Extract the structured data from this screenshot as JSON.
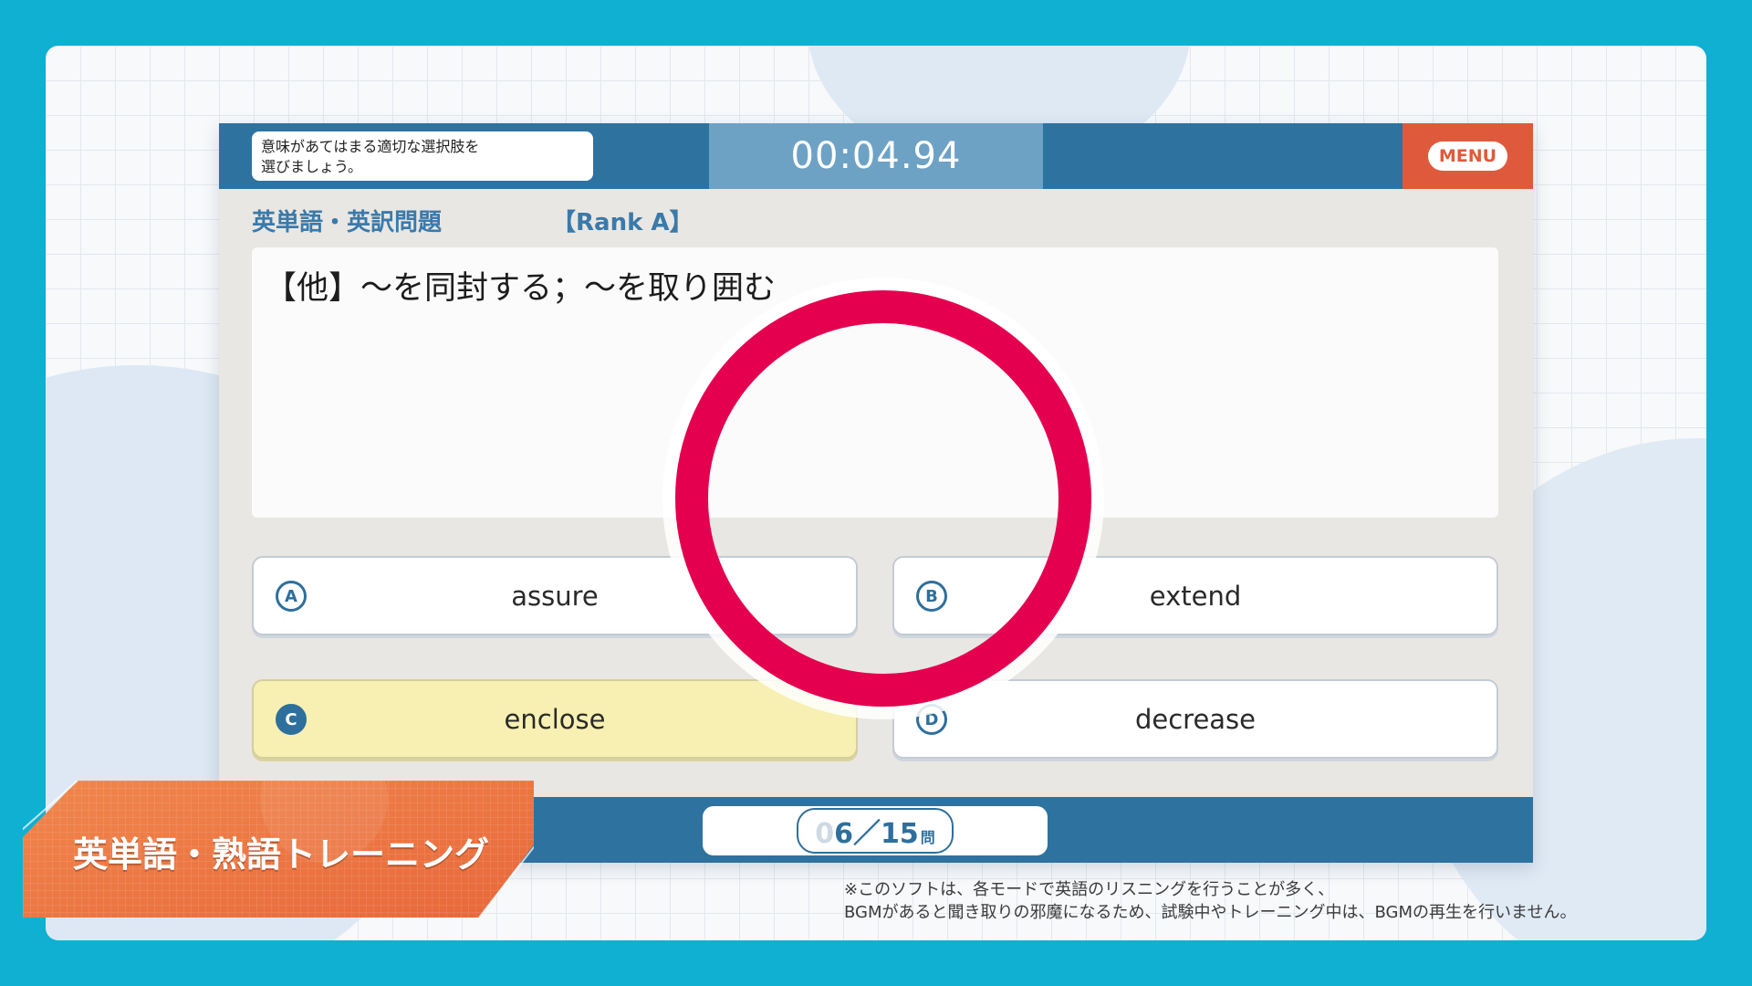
{
  "instruction": {
    "line1": "意味があてはまる適切な選択肢を",
    "line2": "選びましょう。"
  },
  "timer": "00:04.94",
  "menu_label": "MENU",
  "category_label": "英単語・英訳問題",
  "rank_label": "【Rank A】",
  "question_text": "【他】～を同封する；～を取り囲む",
  "choices": [
    {
      "key": "A",
      "word": "assure"
    },
    {
      "key": "B",
      "word": "extend"
    },
    {
      "key": "C",
      "word": "enclose"
    },
    {
      "key": "D",
      "word": "decrease"
    }
  ],
  "selected_choice": "C",
  "result_mark": "correct-circle",
  "counter": {
    "lead": "0",
    "value": "6／15",
    "unit": "問"
  },
  "banner_title": "英単語・熟語トレーニング",
  "footnote": {
    "line1": "※このソフトは、各モードで英語のリスニングを行うことが多く、",
    "line2": "BGMがあると聞き取りの邪魔になるため、試験中やトレーニング中は、BGMの再生を行いません。"
  },
  "colors": {
    "background": "#10b0d2",
    "header": "#2e729f",
    "timer_panel": "#6da2c5",
    "menu": "#df5a3c",
    "selected": "#f8f0b2",
    "ring": "#e5004f",
    "banner": "#ec7a44"
  }
}
